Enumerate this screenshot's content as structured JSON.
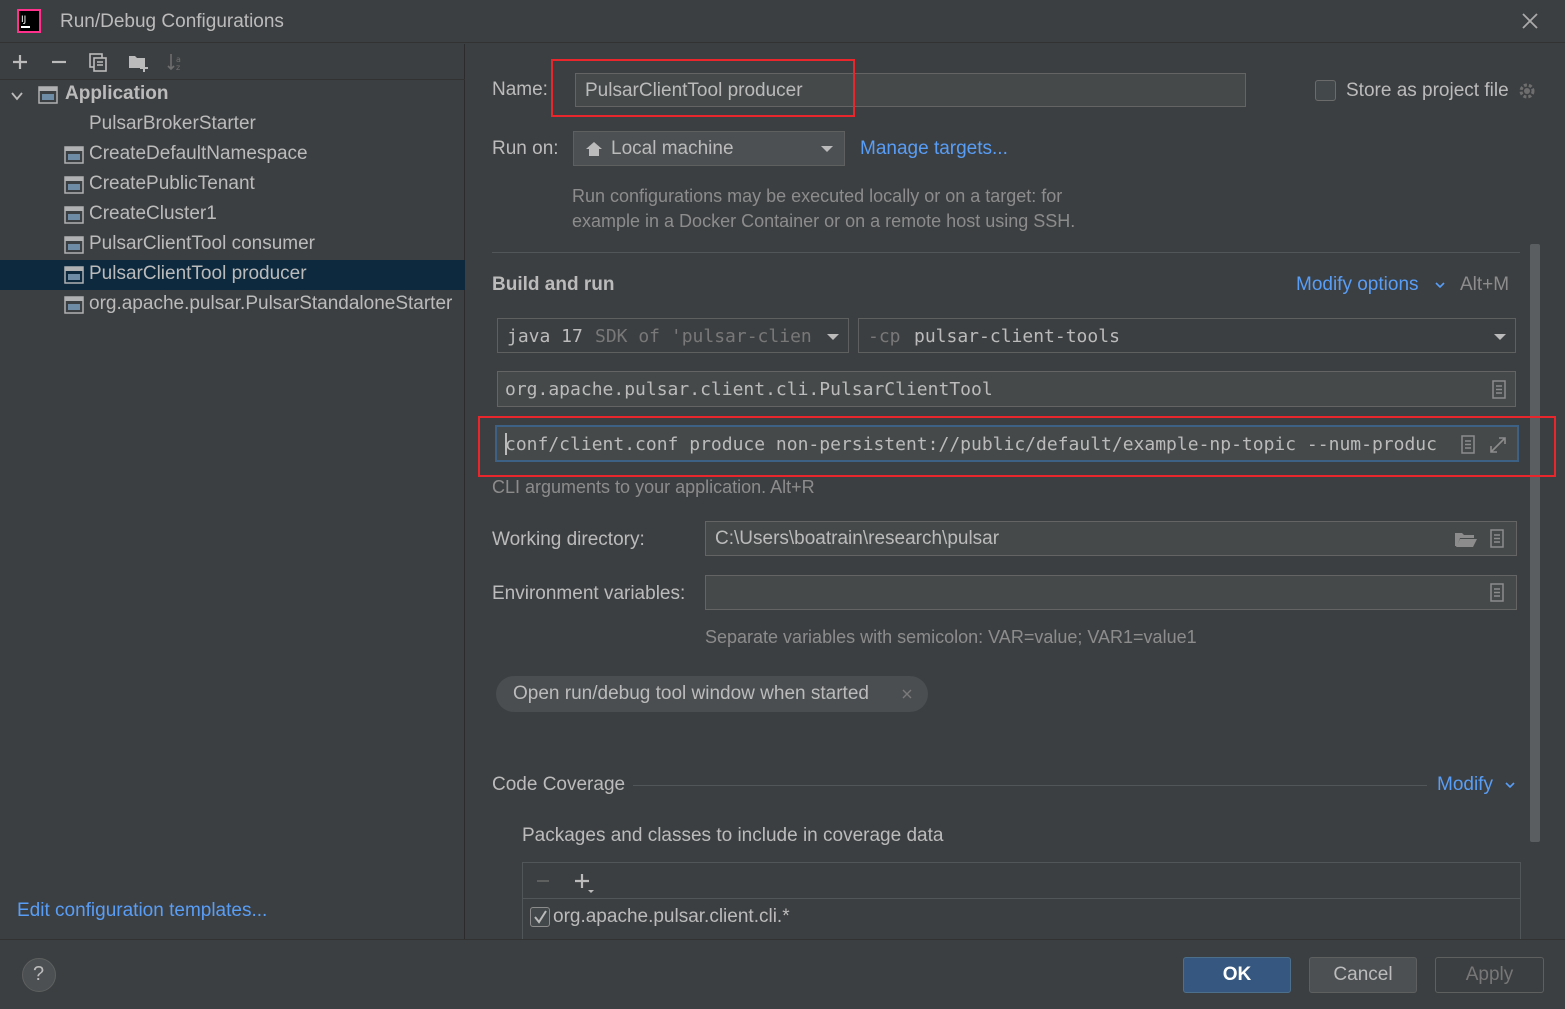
{
  "window": {
    "title": "Run/Debug Configurations"
  },
  "sidebar": {
    "group_label": "Application",
    "items": [
      {
        "label": "PulsarBrokerStarter"
      },
      {
        "label": "CreateDefaultNamespace"
      },
      {
        "label": "CreatePublicTenant"
      },
      {
        "label": "CreateCluster1"
      },
      {
        "label": "PulsarClientTool consumer"
      },
      {
        "label": "PulsarClientTool producer",
        "selected": true
      },
      {
        "label": "org.apache.pulsar.PulsarStandaloneStarter"
      }
    ],
    "edit_templates_link": "Edit configuration templates..."
  },
  "form": {
    "name_label": "Name:",
    "name_value": "PulsarClientTool producer",
    "store_as_project_file_label": "Store as project file",
    "run_on_label": "Run on:",
    "run_on_value": "Local machine",
    "manage_targets_link": "Manage targets...",
    "run_on_hint_line1": "Run configurations may be executed locally or on a target: for",
    "run_on_hint_line2": "example in a Docker Container or on a remote host using SSH.",
    "build_and_run_title": "Build and run",
    "modify_options_link": "Modify options",
    "modify_options_shortcut": "Alt+M",
    "jdk_main": "java 17",
    "jdk_secondary": "SDK of 'pulsar-clien",
    "classpath_prefix": "-cp",
    "classpath_value": "pulsar-client-tools",
    "main_class": "org.apache.pulsar.client.cli.PulsarClientTool",
    "program_args": "conf/client.conf produce non-persistent://public/default/example-np-topic --num-produc",
    "program_args_hint": "CLI arguments to your application. Alt+R",
    "working_dir_label": "Working directory:",
    "working_dir_value": "C:\\Users\\boatrain\\research\\pulsar",
    "env_vars_label": "Environment variables:",
    "env_vars_value": "",
    "env_vars_hint": "Separate variables with semicolon: VAR=value; VAR1=value1",
    "option_chip": "Open run/debug tool window when started",
    "code_coverage_title": "Code Coverage",
    "code_coverage_modify": "Modify",
    "coverage_packages_label": "Packages and classes to include in coverage data",
    "coverage_items": [
      {
        "label": "org.apache.pulsar.client.cli.*",
        "checked": true
      }
    ]
  },
  "buttons": {
    "ok": "OK",
    "cancel": "Cancel",
    "apply": "Apply"
  },
  "colors": {
    "accent": "#365880",
    "link": "#589df6",
    "highlight_box": "#e8262b",
    "selection": "#0d293e"
  },
  "icons": [
    "app-logo-icon",
    "close-icon",
    "add-icon",
    "remove-icon",
    "copy-icon",
    "folder-add-icon",
    "sort-icon",
    "chevron-down-icon",
    "config-icon",
    "home-icon",
    "dropdown-arrow-icon",
    "gear-icon",
    "browse-icon",
    "expand-icon",
    "folder-icon",
    "help-icon"
  ]
}
